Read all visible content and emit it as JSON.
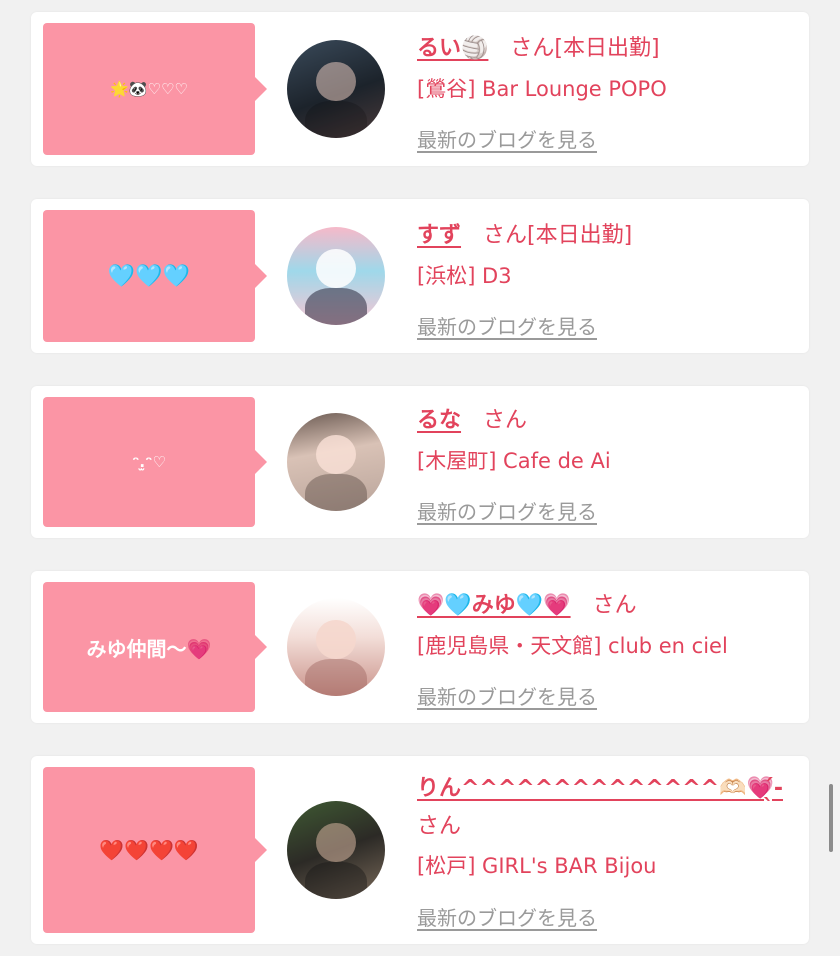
{
  "honorific": "さん",
  "blog_link_label": "最新のブログを見る",
  "colors": {
    "bubble": "#fb95a5",
    "accent_text": "#e2435c",
    "muted_link": "#9a9a9a",
    "background": "#f1f1f1"
  },
  "cards": [
    {
      "bubble_text": "🌟🐼♡♡♡",
      "name": "るい🏐",
      "status": "[本日出勤]",
      "shop": "[鶯谷] Bar Lounge POPO"
    },
    {
      "bubble_text": "🩵🩵🩵",
      "name": "すず",
      "status": "[本日出勤]",
      "shop": "[浜松] D3"
    },
    {
      "bubble_text": "ᵔ.̫ᵔ♡",
      "name": "るな",
      "status": "",
      "shop": "[木屋町] Cafe de Ai"
    },
    {
      "bubble_text": "みゆ仲間〜💗",
      "name": "💗🩵みゆ🩵💗",
      "status": "",
      "shop": "[鹿児島県・天文館] club en ciel"
    },
    {
      "bubble_text": "❤️❤️❤️❤️",
      "name": "りん^^^^^^^^^^^^^^🫶🏻💗̖́-",
      "status": "",
      "shop": "[松戸] GIRL's BAR Bijou"
    }
  ]
}
